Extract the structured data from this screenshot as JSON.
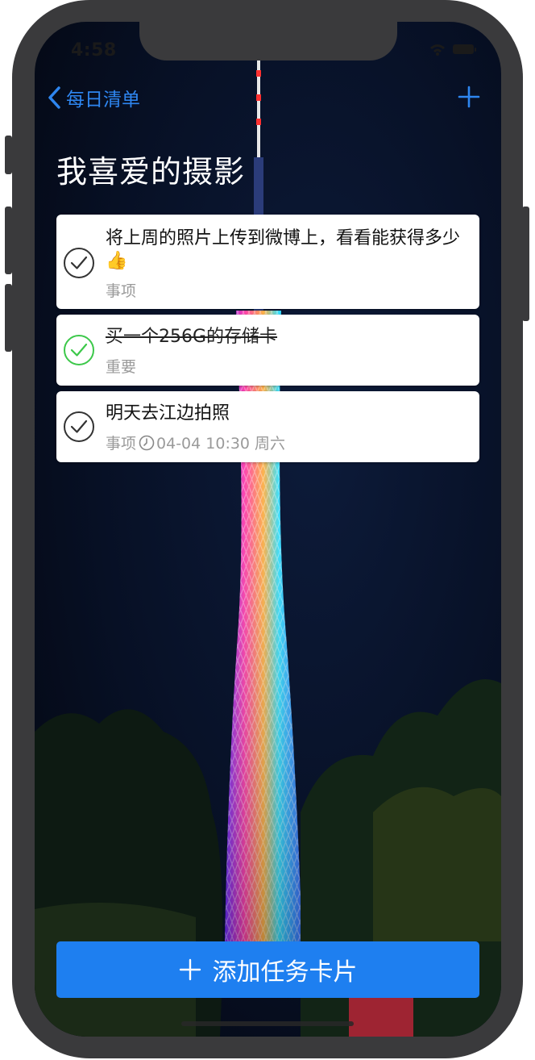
{
  "status_bar": {
    "time": "4:58"
  },
  "nav": {
    "back_label": "每日清单",
    "back_icon": "chevron-left-icon",
    "add_icon": "plus-icon"
  },
  "page": {
    "title": "我喜爱的摄影"
  },
  "tasks": [
    {
      "title": "将上周的照片上传到微博上，看看能获得多少👍",
      "category": "事项",
      "completed": false,
      "due": ""
    },
    {
      "title": "买一个256G的存储卡",
      "category": "重要",
      "completed": true,
      "due": ""
    },
    {
      "title": "明天去江边拍照",
      "category": "事项",
      "completed": false,
      "due": "04-04 10:30 周六"
    }
  ],
  "footer": {
    "add_button_label": "添加任务卡片"
  },
  "colors": {
    "accent": "#2e86f0",
    "button": "#1e7ff0",
    "check_done": "#3cc84a",
    "check_pending": "#333333",
    "meta_text": "#9a9a9a"
  }
}
